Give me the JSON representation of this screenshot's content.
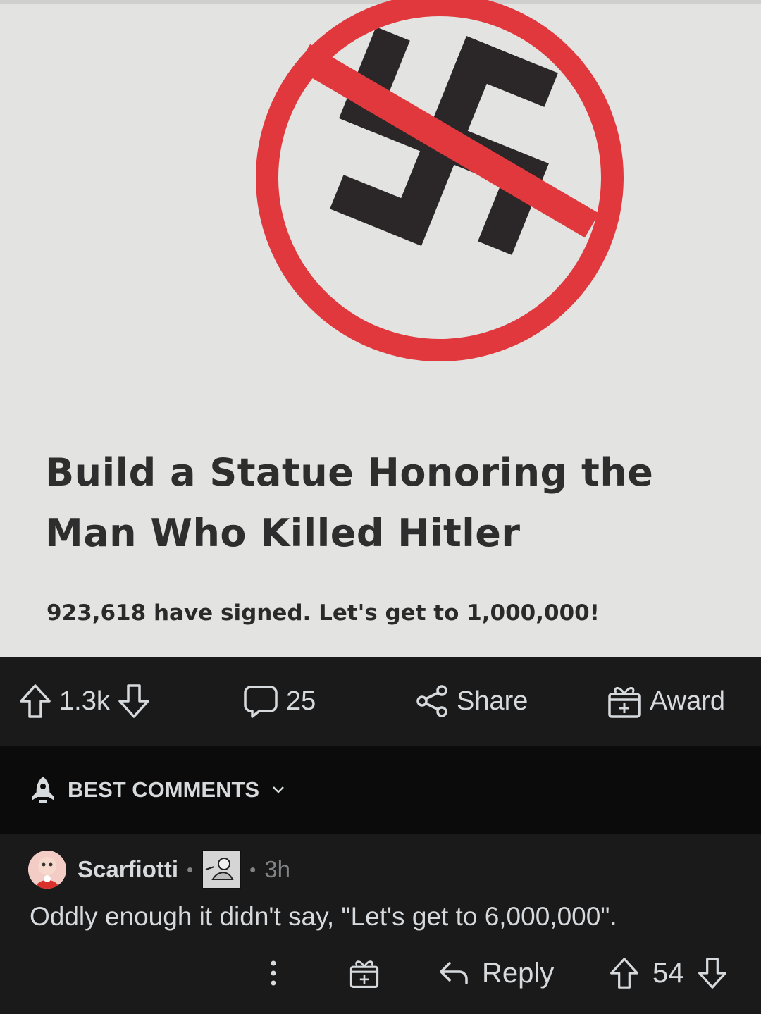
{
  "post": {
    "image": {
      "title": "Build a Statue Honoring the Man Who Killed Hitler",
      "signatures": "923,618 have signed. Let's get to 1,000,000!",
      "sign_icon": "prohibited-swastika-sign"
    },
    "actions": {
      "upvotes": "1.3k",
      "comments": "25",
      "share": "Share",
      "award": "Award"
    }
  },
  "sort": {
    "label": "BEST COMMENTS",
    "icon": "rocket-icon"
  },
  "comment": {
    "username": "Scarfiotti",
    "separator": "•",
    "age": "3h",
    "body": "Oddly enough it didn't say, \"Let's get to 6,000,000\".",
    "reply": "Reply",
    "score": "54"
  },
  "colors": {
    "background": "#000000",
    "panel": "#1a1a1b",
    "sortbar": "#0b0b0b",
    "text": "#d7dadc",
    "muted": "#818384",
    "sign_red": "#e0383c"
  }
}
